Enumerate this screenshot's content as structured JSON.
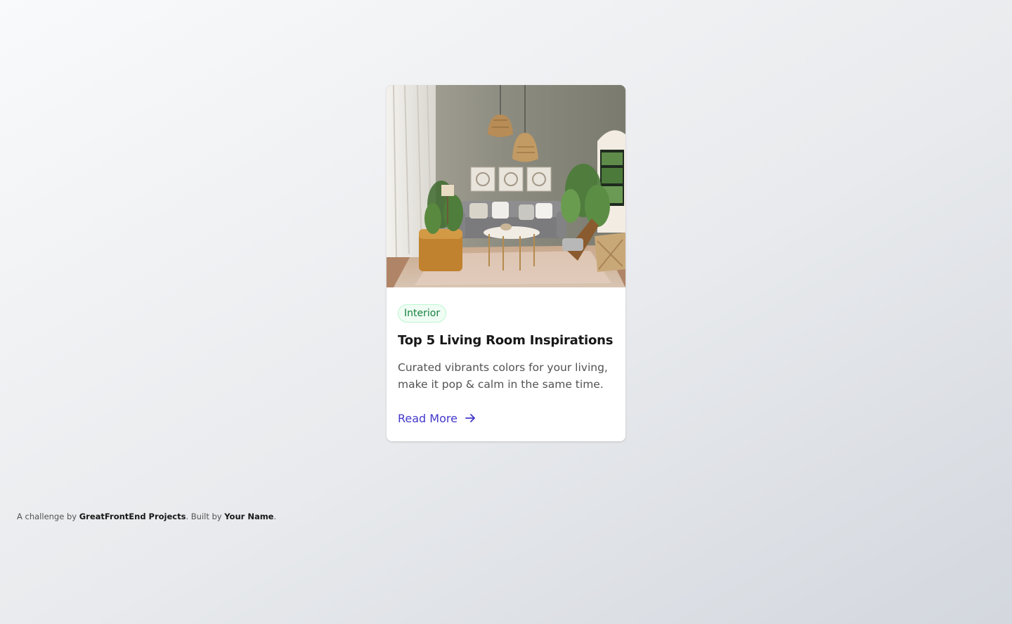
{
  "card": {
    "badge": "Interior",
    "title": "Top 5 Living Room Inspirations",
    "description": "Curated vibrants colors for your living, make it pop & calm in the same time.",
    "link_label": "Read More",
    "link_icon": "arrow-right-icon",
    "image_subject": "living-room-photo"
  },
  "footer": {
    "prefix": "A challenge by ",
    "brand": "GreatFrontEnd Projects",
    "middle": ". Built by ",
    "author": "Your Name",
    "suffix": "."
  },
  "colors": {
    "accent": "#4338ca",
    "badge_text": "#15803d",
    "badge_bg": "#f0fdf4",
    "badge_border": "#bbf7d0"
  }
}
